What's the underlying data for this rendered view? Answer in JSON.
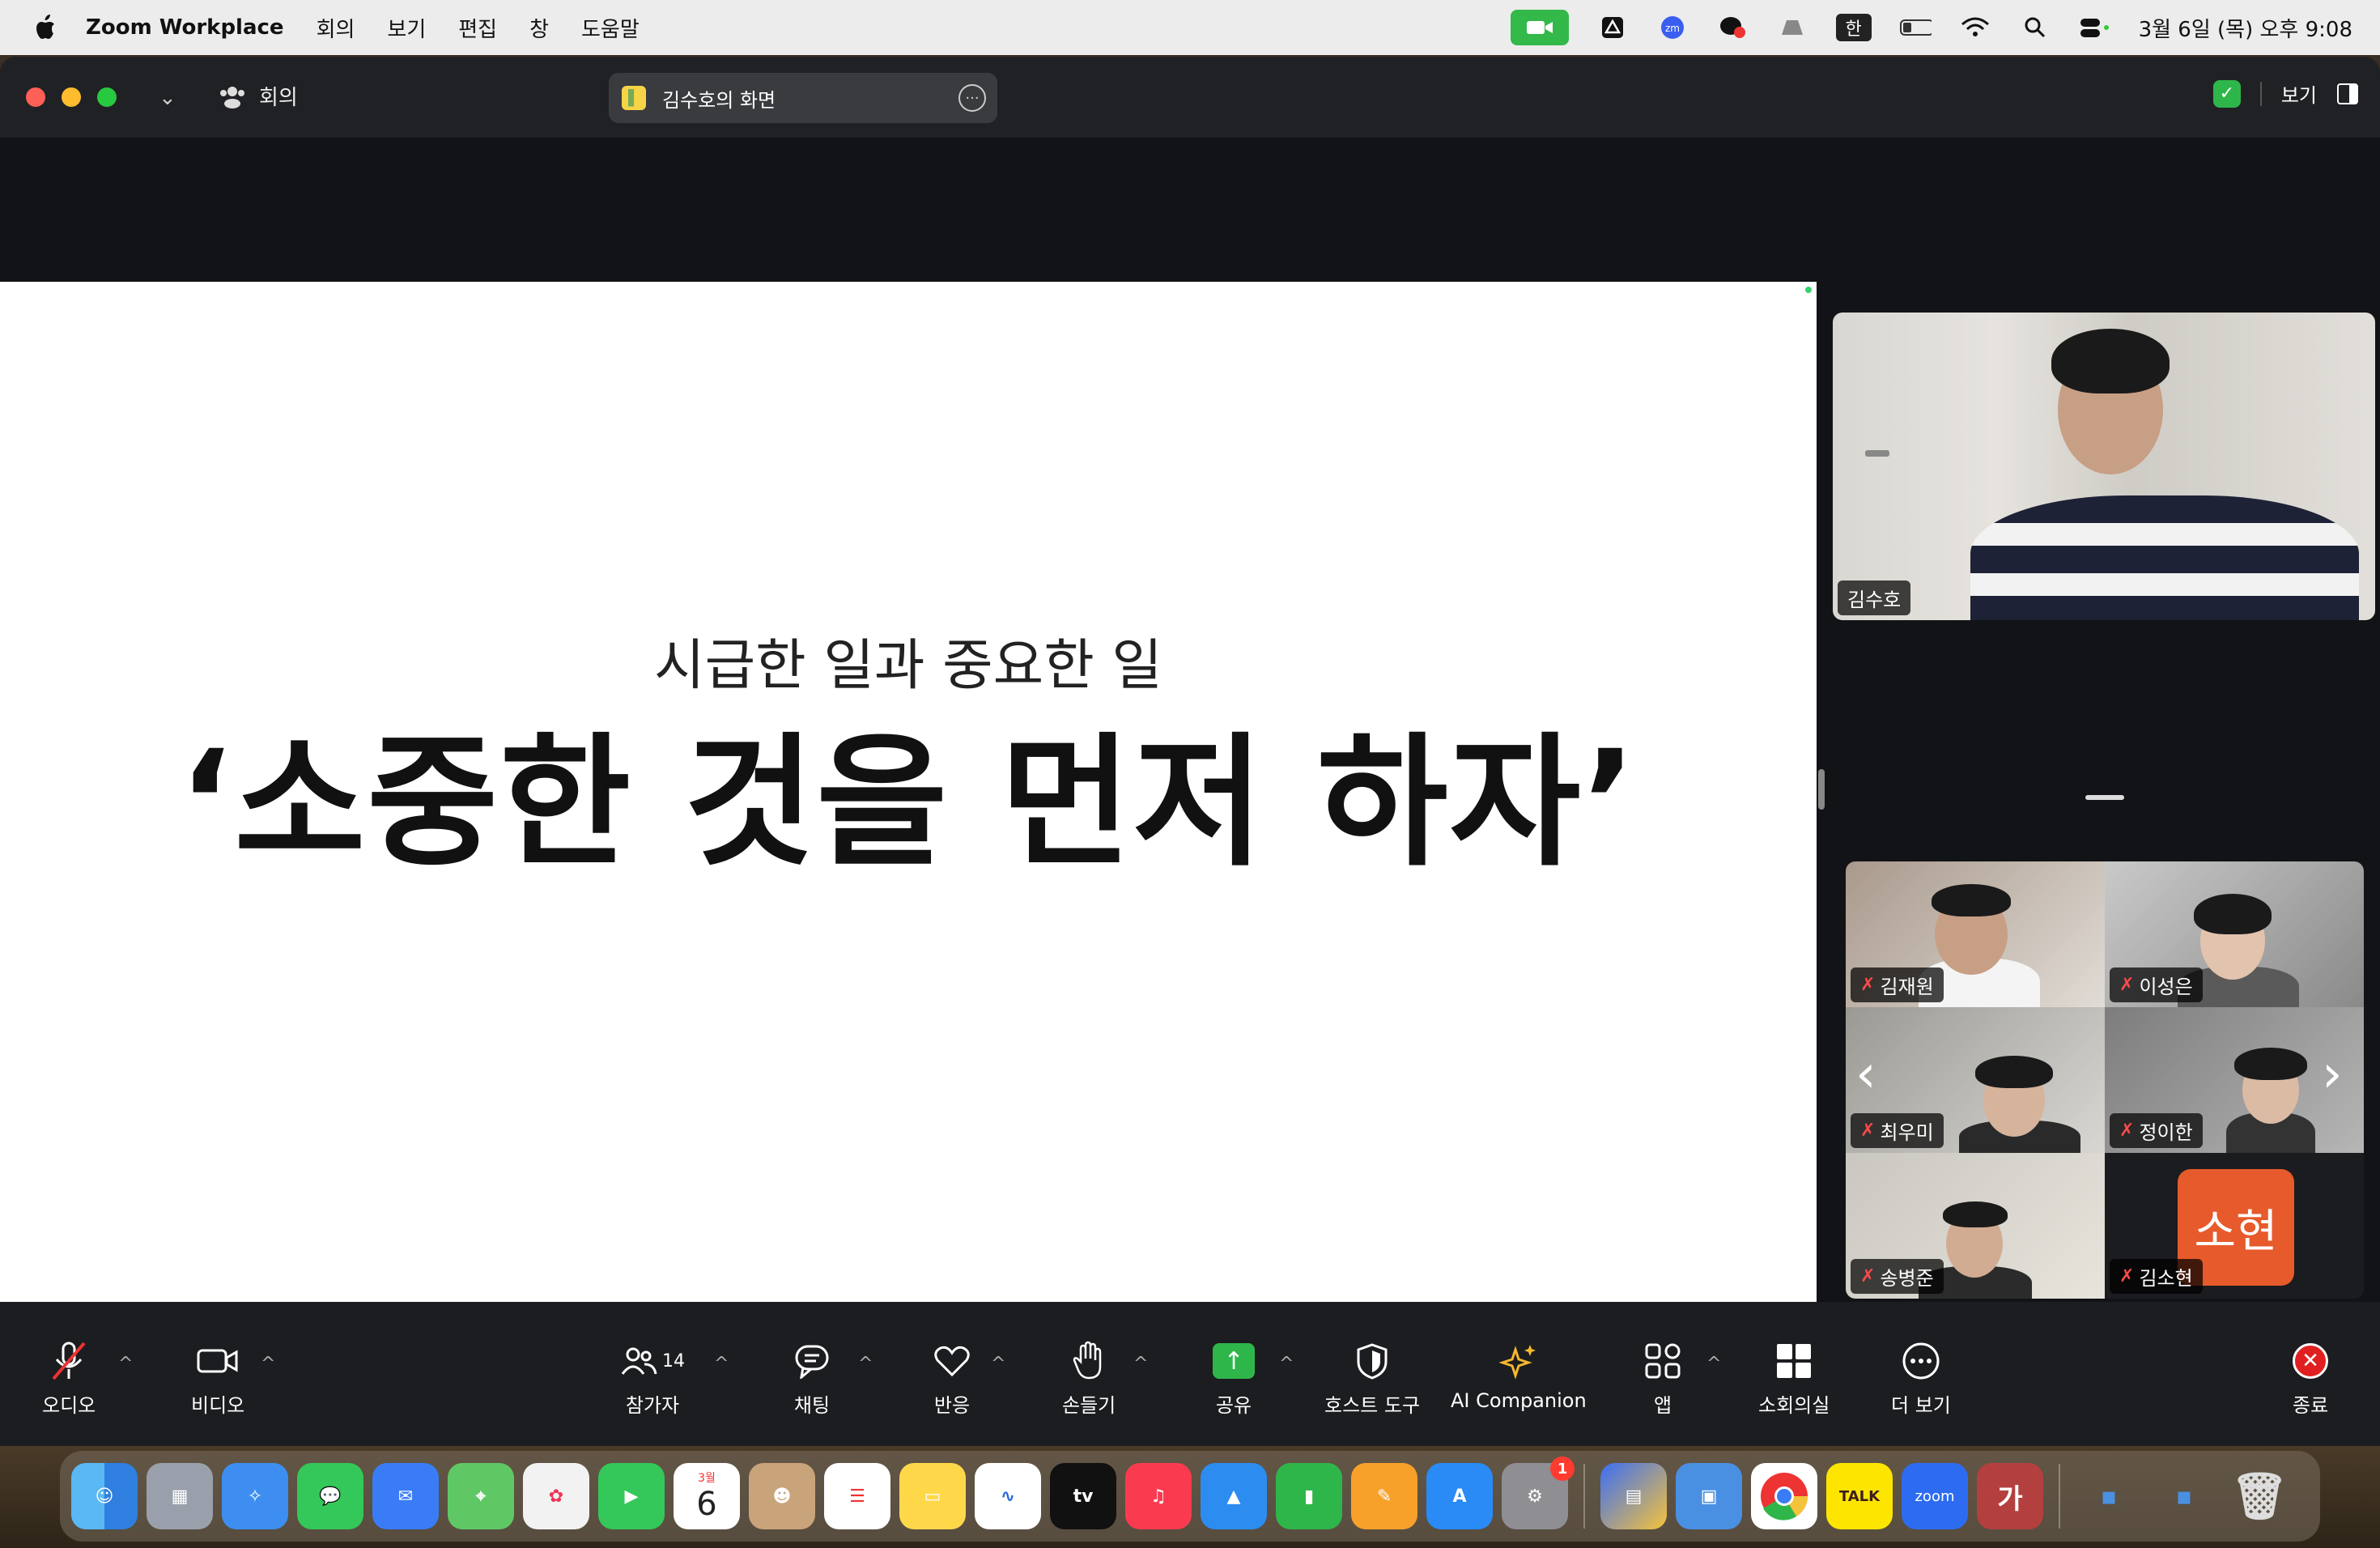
{
  "menubar": {
    "app_name": "Zoom Workplace",
    "menus": [
      "회의",
      "보기",
      "편집",
      "창",
      "도움말"
    ],
    "clock": "3월 6일 (목) 오후 9:08",
    "input_method": "한"
  },
  "titlebar": {
    "meeting_label": "회의",
    "share_title": "김수호의 화면",
    "view_label": "보기"
  },
  "slide": {
    "subtitle": "시급한 일과 중요한 일",
    "headline": "‘소중한 것을 먼저 하자’"
  },
  "speaker": {
    "name": "김수호"
  },
  "participants": [
    {
      "name": "김재원"
    },
    {
      "name": "이성은"
    },
    {
      "name": "최우미"
    },
    {
      "name": "정이한"
    },
    {
      "name": "송병준"
    },
    {
      "name": "김소현",
      "avatar_text": "소현",
      "avatar_color": "#e75a2b"
    }
  ],
  "controls": {
    "audio": "오디오",
    "video": "비디오",
    "participants": "참가자",
    "participants_count": "14",
    "chat": "채팅",
    "reactions": "반응",
    "raise_hand": "손들기",
    "share": "공유",
    "host_tools": "호스트 도구",
    "ai_companion": "AI Companion",
    "apps": "앱",
    "breakout": "소회의실",
    "more": "더 보기",
    "end": "종료"
  },
  "dock": {
    "calendar_month": "3월",
    "calendar_day": "6",
    "tv_label": "tv",
    "talk_label": "TALK",
    "zoom_label": "zoom",
    "ga_label": "가",
    "settings_badge": "1"
  },
  "colors": {
    "zoom_green": "#2fb64a",
    "end_red": "#e02020",
    "accent_orange": "#e75a2b"
  }
}
